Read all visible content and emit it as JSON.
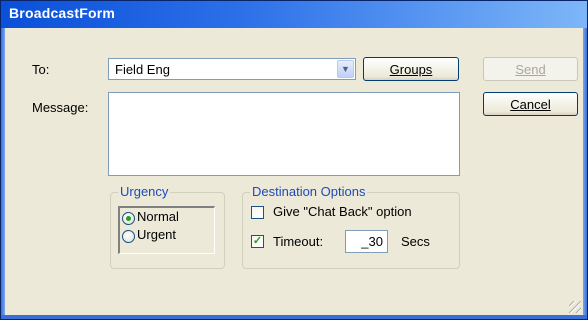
{
  "window": {
    "title": "BroadcastForm"
  },
  "form": {
    "to_label": "To:",
    "to_value": "Field Eng",
    "message_label": "Message:",
    "message_value": ""
  },
  "buttons": {
    "groups": "Groups",
    "send": "Send",
    "cancel": "Cancel"
  },
  "urgency": {
    "title": "Urgency",
    "options": [
      "Normal",
      "Urgent"
    ],
    "selected": "Normal"
  },
  "destination": {
    "title": "Destination Options",
    "chat_back_label": "Give \"Chat Back\" option",
    "chat_back_checked": false,
    "timeout_label": "Timeout:",
    "timeout_checked": true,
    "timeout_value": "_30",
    "timeout_unit": "Secs"
  },
  "icons": [
    "dropdown-arrow-icon",
    "size-grip-icon"
  ]
}
